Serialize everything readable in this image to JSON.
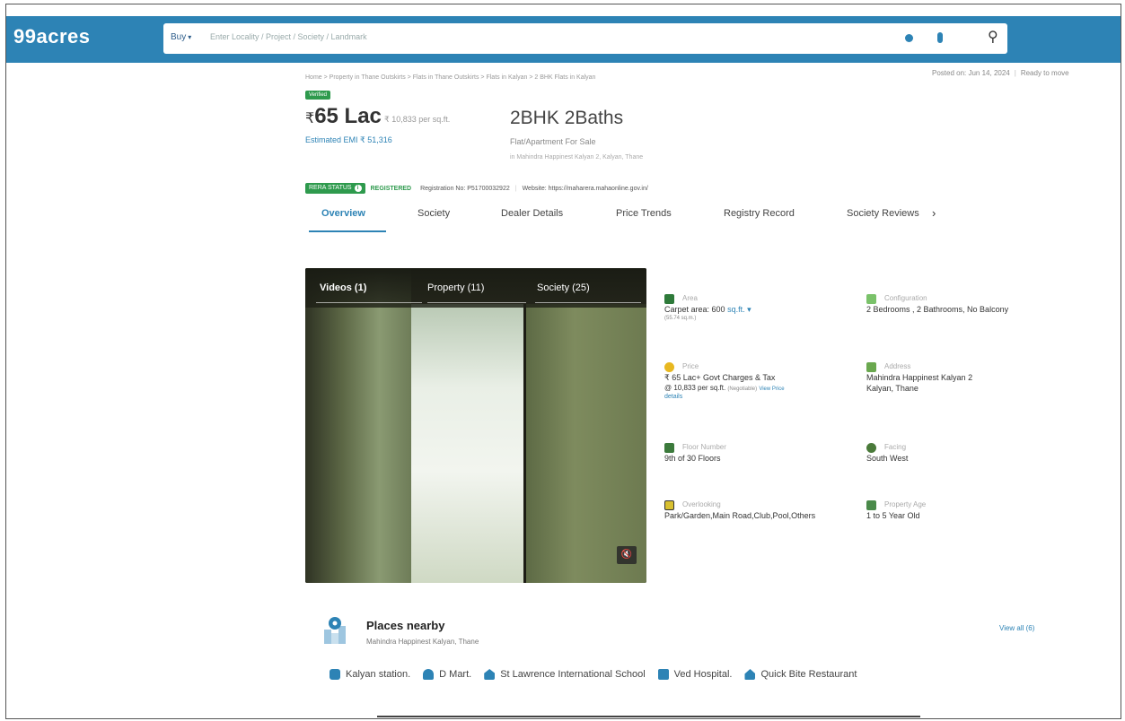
{
  "header": {
    "logo": "99acres",
    "buy_label": "Buy",
    "search_placeholder": "Enter Locality / Project / Society / Landmark"
  },
  "breadcrumb": "Home > Property in Thane Outskirts > Flats in Thane Outskirts > Flats in Kalyan > 2 BHK Flats in Kalyan",
  "posted_on": "Posted on: Jun 14, 2024",
  "ready_to_move": "Ready to move",
  "verified_label": "Verified",
  "listing": {
    "price": "65 Lac",
    "currency": "₹",
    "price_per_sqft": "₹ 10,833 per sq.ft.",
    "emi": "Estimated EMI ₹ 51,316",
    "title": "2BHK 2Baths",
    "subtitle": "Flat/Apartment For Sale",
    "locality": "in Mahindra Happinest Kalyan 2, Kalyan, Thane"
  },
  "rera": {
    "status_label": "RERA STATUS",
    "registered_label": "REGISTERED",
    "registration_no": "Registration No: P51700032922",
    "website": "Website: https://maharera.mahaonline.gov.in/"
  },
  "tabs": [
    {
      "label": "Overview"
    },
    {
      "label": "Society"
    },
    {
      "label": "Dealer Details"
    },
    {
      "label": "Price Trends"
    },
    {
      "label": "Registry Record"
    },
    {
      "label": "Society Reviews"
    }
  ],
  "media": {
    "tabs": [
      {
        "label": "Videos (1)"
      },
      {
        "label": "Property (11)"
      },
      {
        "label": "Society (25)"
      }
    ]
  },
  "details": {
    "area": {
      "label": "Area",
      "value": "Carpet area: 600",
      "unit": "sq.ft.",
      "sub": "(55.74 sq.m.)"
    },
    "configuration": {
      "label": "Configuration",
      "value": "2 Bedrooms , 2 Bathrooms, No Balcony"
    },
    "price": {
      "label": "Price",
      "value": "₹ 65 Lac+ Govt Charges & Tax",
      "value2": "@ 10,833 per sq.ft.",
      "negotiable": "(Negotiable)",
      "view_price": "View Price",
      "details_link": "details"
    },
    "address": {
      "label": "Address",
      "value": "Mahindra Happinest Kalyan 2",
      "value2": "Kalyan, Thane"
    },
    "floor": {
      "label": "Floor Number",
      "value": "9th of 30 Floors"
    },
    "facing": {
      "label": "Facing",
      "value": "South West"
    },
    "overlooking": {
      "label": "Overlooking",
      "value": "Park/Garden,Main Road,Club,Pool,Others"
    },
    "age": {
      "label": "Property Age",
      "value": "1 to 5 Year Old"
    }
  },
  "places": {
    "title": "Places nearby",
    "subtitle": "Mahindra Happinest Kalyan, Thane",
    "view_all": "View all (6)",
    "items": [
      {
        "label": "Kalyan station.",
        "color": "#2d83b5"
      },
      {
        "label": "D Mart.",
        "color": "#2d83b5"
      },
      {
        "label": "St Lawrence International School",
        "color": "#2d83b5"
      },
      {
        "label": "Ved Hospital.",
        "color": "#2d83b5"
      },
      {
        "label": "Quick Bite Restaurant",
        "color": "#2d83b5"
      }
    ]
  },
  "colors": {
    "brand": "#2d83b5",
    "green": "#2e9a4d"
  }
}
